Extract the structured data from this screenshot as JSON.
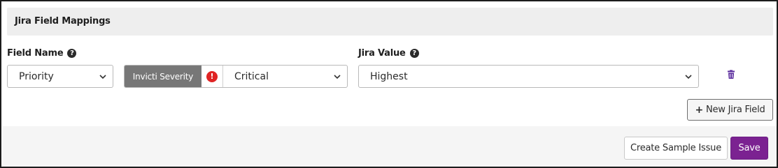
{
  "section": {
    "title": "Jira Field Mappings"
  },
  "labels": {
    "field_name": "Field Name",
    "jira_value": "Jira Value"
  },
  "mapping_row": {
    "field_name_value": "Priority",
    "severity_label": "Invicti Severity",
    "severity_value": "Critical",
    "jira_value": "Highest"
  },
  "buttons": {
    "new_jira_field": "New Jira Field",
    "create_sample_issue": "Create Sample Issue",
    "save": "Save"
  },
  "icons": {
    "help": "question-circle-icon",
    "alert": "exclamation-circle-icon",
    "delete": "trash-icon",
    "add": "plus-icon",
    "dropdown": "chevron-down-icon"
  },
  "colors": {
    "primary": "#7b2291",
    "alert": "#e02424",
    "severity_badge": "#777777",
    "trash": "#5b2d9e"
  }
}
